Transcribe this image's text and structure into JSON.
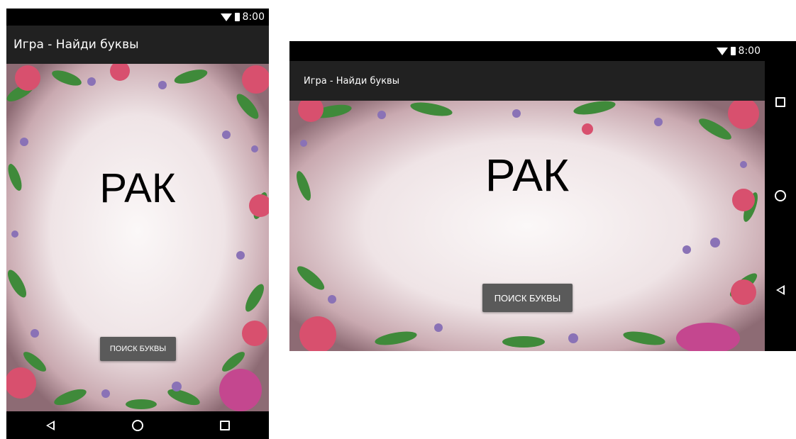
{
  "status": {
    "time": "8:00"
  },
  "app": {
    "title": "Игра - Найди буквы",
    "word": "РАК",
    "button_label": "поиск буквы"
  },
  "navbar": [
    "back-icon",
    "home-icon",
    "recents-icon"
  ],
  "colors": {
    "appbar": "#212121",
    "button": "#5a5a5a",
    "status_bar": "#000000",
    "leaf": "#3f8a3a",
    "rose": "#d8506e",
    "lilac": "#8a72b6"
  }
}
